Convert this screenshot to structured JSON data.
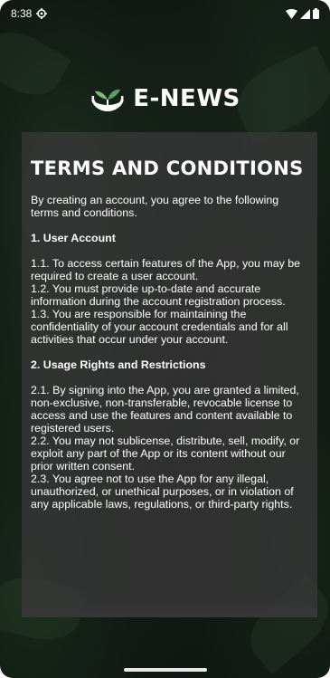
{
  "status": {
    "time": "8:38",
    "icons": [
      "settings-icon",
      "wifi-icon",
      "signal-icon",
      "battery-icon"
    ]
  },
  "app": {
    "name": "E-NEWS",
    "logo_icon": "hands-plant-icon"
  },
  "terms": {
    "title": "TERMS AND CONDITIONS",
    "intro": "By creating an account, you agree to the following terms and conditions.",
    "sections": [
      {
        "heading": "1. User Account",
        "items": [
          "1.1. To access certain features of the App, you may be required to create a user account.",
          "1.2. You must provide up-to-date and accurate information during the account registration process.",
          "1.3. You are responsible for maintaining the confidentiality of your account credentials and for all activities that occur under your account."
        ]
      },
      {
        "heading": "2. Usage Rights and Restrictions",
        "items": [
          "2.1. By signing into the App, you are granted a limited, non-exclusive, non-transferable, revocable license to access and use the features and content available to registered users.",
          "2.2. You may not sublicense, distribute, sell, modify, or exploit any part of the App or its content without our prior written consent.",
          "2.3. You agree not to use the App for any illegal, unauthorized, or unethical purposes, or in violation of any applicable laws, regulations, or third-party rights."
        ]
      }
    ]
  },
  "colors": {
    "card_bg": "#373737",
    "text": "#ffffff",
    "logo_green": "#7fb77e"
  }
}
